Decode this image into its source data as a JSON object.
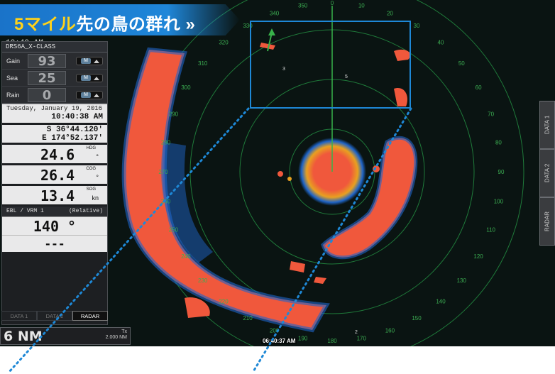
{
  "banner": {
    "highlight": "5マイル",
    "text": "先の鳥の群れ",
    "arrows": "»"
  },
  "time_top": "10:40 AM",
  "panel": {
    "radar_name": "DRS6A_X-CLASS",
    "controls": [
      {
        "label": "Gain",
        "value": "93",
        "mode": "M"
      },
      {
        "label": "Sea",
        "value": "25",
        "mode": "M"
      },
      {
        "label": "Rain",
        "value": "0",
        "mode": "M"
      }
    ],
    "date": "Tuesday, January 19, 2016",
    "time": "10:40:38 AM",
    "lat": "S 36°44.120'",
    "lon": "E 174°52.137'",
    "hdg": {
      "value": "24.6",
      "unit": "°",
      "label": "HDG"
    },
    "cog": {
      "value": "26.4",
      "unit": "°",
      "label": "COG"
    },
    "sog": {
      "value": "13.4",
      "unit": "kn",
      "label": "SOG"
    },
    "ebl": {
      "title": "EBL / VRM 1",
      "mode": "(Relative)",
      "value": "140 °",
      "value2": "---"
    }
  },
  "tabs": [
    "DATA 1",
    "DATA 2",
    "RADAR"
  ],
  "range": {
    "value": "6 NM",
    "tx_label": "Tx",
    "tx_value": "2.000 NM"
  },
  "bottom_time": "06:40:37 AM",
  "right_tabs": [
    "DATA 1",
    "DATA 2",
    "RADAR"
  ],
  "bearings": [
    "350",
    "0",
    "10",
    "20",
    "30",
    "40",
    "50",
    "60",
    "70",
    "80",
    "90",
    "100",
    "110",
    "120",
    "130",
    "140",
    "150",
    "160",
    "170",
    "180",
    "190",
    "200",
    "210",
    "220",
    "230",
    "240",
    "250",
    "260",
    "270",
    "280",
    "290",
    "300",
    "310",
    "320",
    "330",
    "340"
  ],
  "zoom_labels": [
    "3",
    "5",
    "2"
  ],
  "colors": {
    "echo_strong": "#f0583c",
    "echo_mid": "#e8a020",
    "echo_weak": "#1e64c8",
    "ring": "#1f7a3a",
    "accent": "#1e88d6"
  }
}
